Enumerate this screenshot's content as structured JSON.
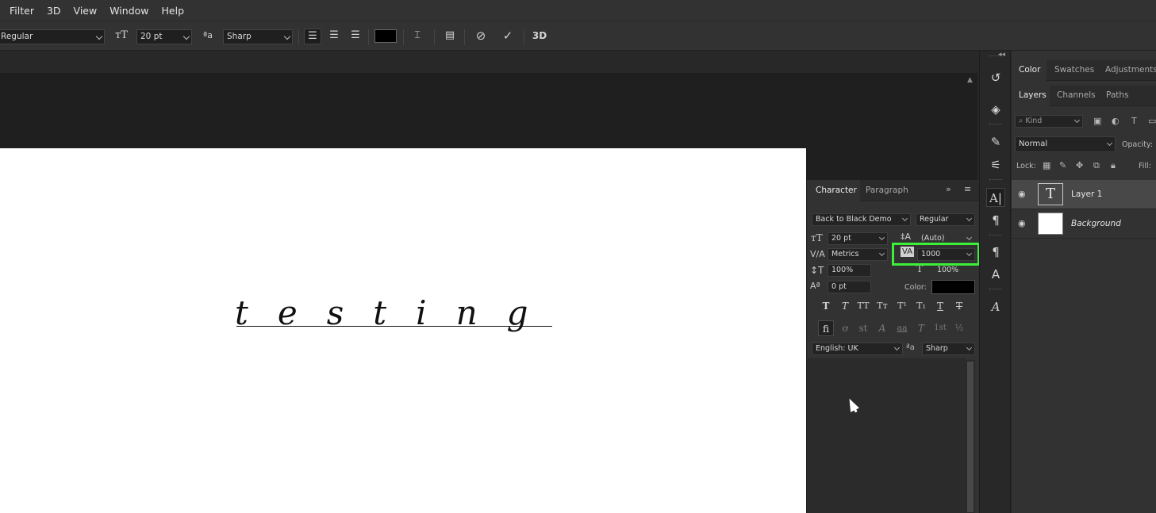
{
  "menu": {
    "items": [
      {
        "key": "filter",
        "label": "Filter"
      },
      {
        "key": "3d",
        "label": "3D"
      },
      {
        "key": "view",
        "label": "View"
      },
      {
        "key": "window",
        "label": "Window"
      },
      {
        "key": "help",
        "label": "Help"
      }
    ]
  },
  "options_bar": {
    "font_style": "Regular",
    "font_size": "20 pt",
    "anti_alias_icon": "aa-icon",
    "anti_alias": "Sharp",
    "text_color": "#000000",
    "label_3d": "3D"
  },
  "canvas": {
    "text": "testing",
    "background": "#ffffff"
  },
  "character_panel": {
    "tabs": [
      {
        "key": "character",
        "label": "Character"
      },
      {
        "key": "paragraph",
        "label": "Paragraph"
      }
    ],
    "font_family": "Back to Black Demo",
    "font_style": "Regular",
    "font_size": "20 pt",
    "leading": "(Auto)",
    "kerning": "Metrics",
    "tracking": "1000",
    "vertical_scale": "100%",
    "horizontal_scale": "100%",
    "baseline_shift": "0 pt",
    "color_label": "Color:",
    "color_value": "#000000",
    "language": "English: UK",
    "anti_alias_icon": "aa-icon",
    "anti_alias": "Sharp",
    "style_buttons_row1": [
      "T",
      "T",
      "TT",
      "Tт",
      "T¹",
      "T₁",
      "T",
      "T"
    ],
    "style_buttons_row2": [
      "fi",
      "ơ",
      "st",
      "A",
      "aa",
      "T",
      "1st",
      "½"
    ]
  },
  "right_panel": {
    "top_tabs": [
      {
        "key": "color",
        "label": "Color"
      },
      {
        "key": "swatches",
        "label": "Swatches"
      },
      {
        "key": "adjustments",
        "label": "Adjustments"
      }
    ],
    "layer_tabs": [
      {
        "key": "layers",
        "label": "Layers"
      },
      {
        "key": "channels",
        "label": "Channels"
      },
      {
        "key": "paths",
        "label": "Paths"
      }
    ],
    "filter_placeholder": "Kind",
    "blend_mode": "Normal",
    "opacity_label": "Opacity:",
    "lock_label": "Lock:",
    "fill_label": "Fill:",
    "layers": [
      {
        "name": "Layer 1",
        "type": "text",
        "selected": true
      },
      {
        "name": "Background",
        "type": "pixel",
        "selected": false
      }
    ]
  }
}
